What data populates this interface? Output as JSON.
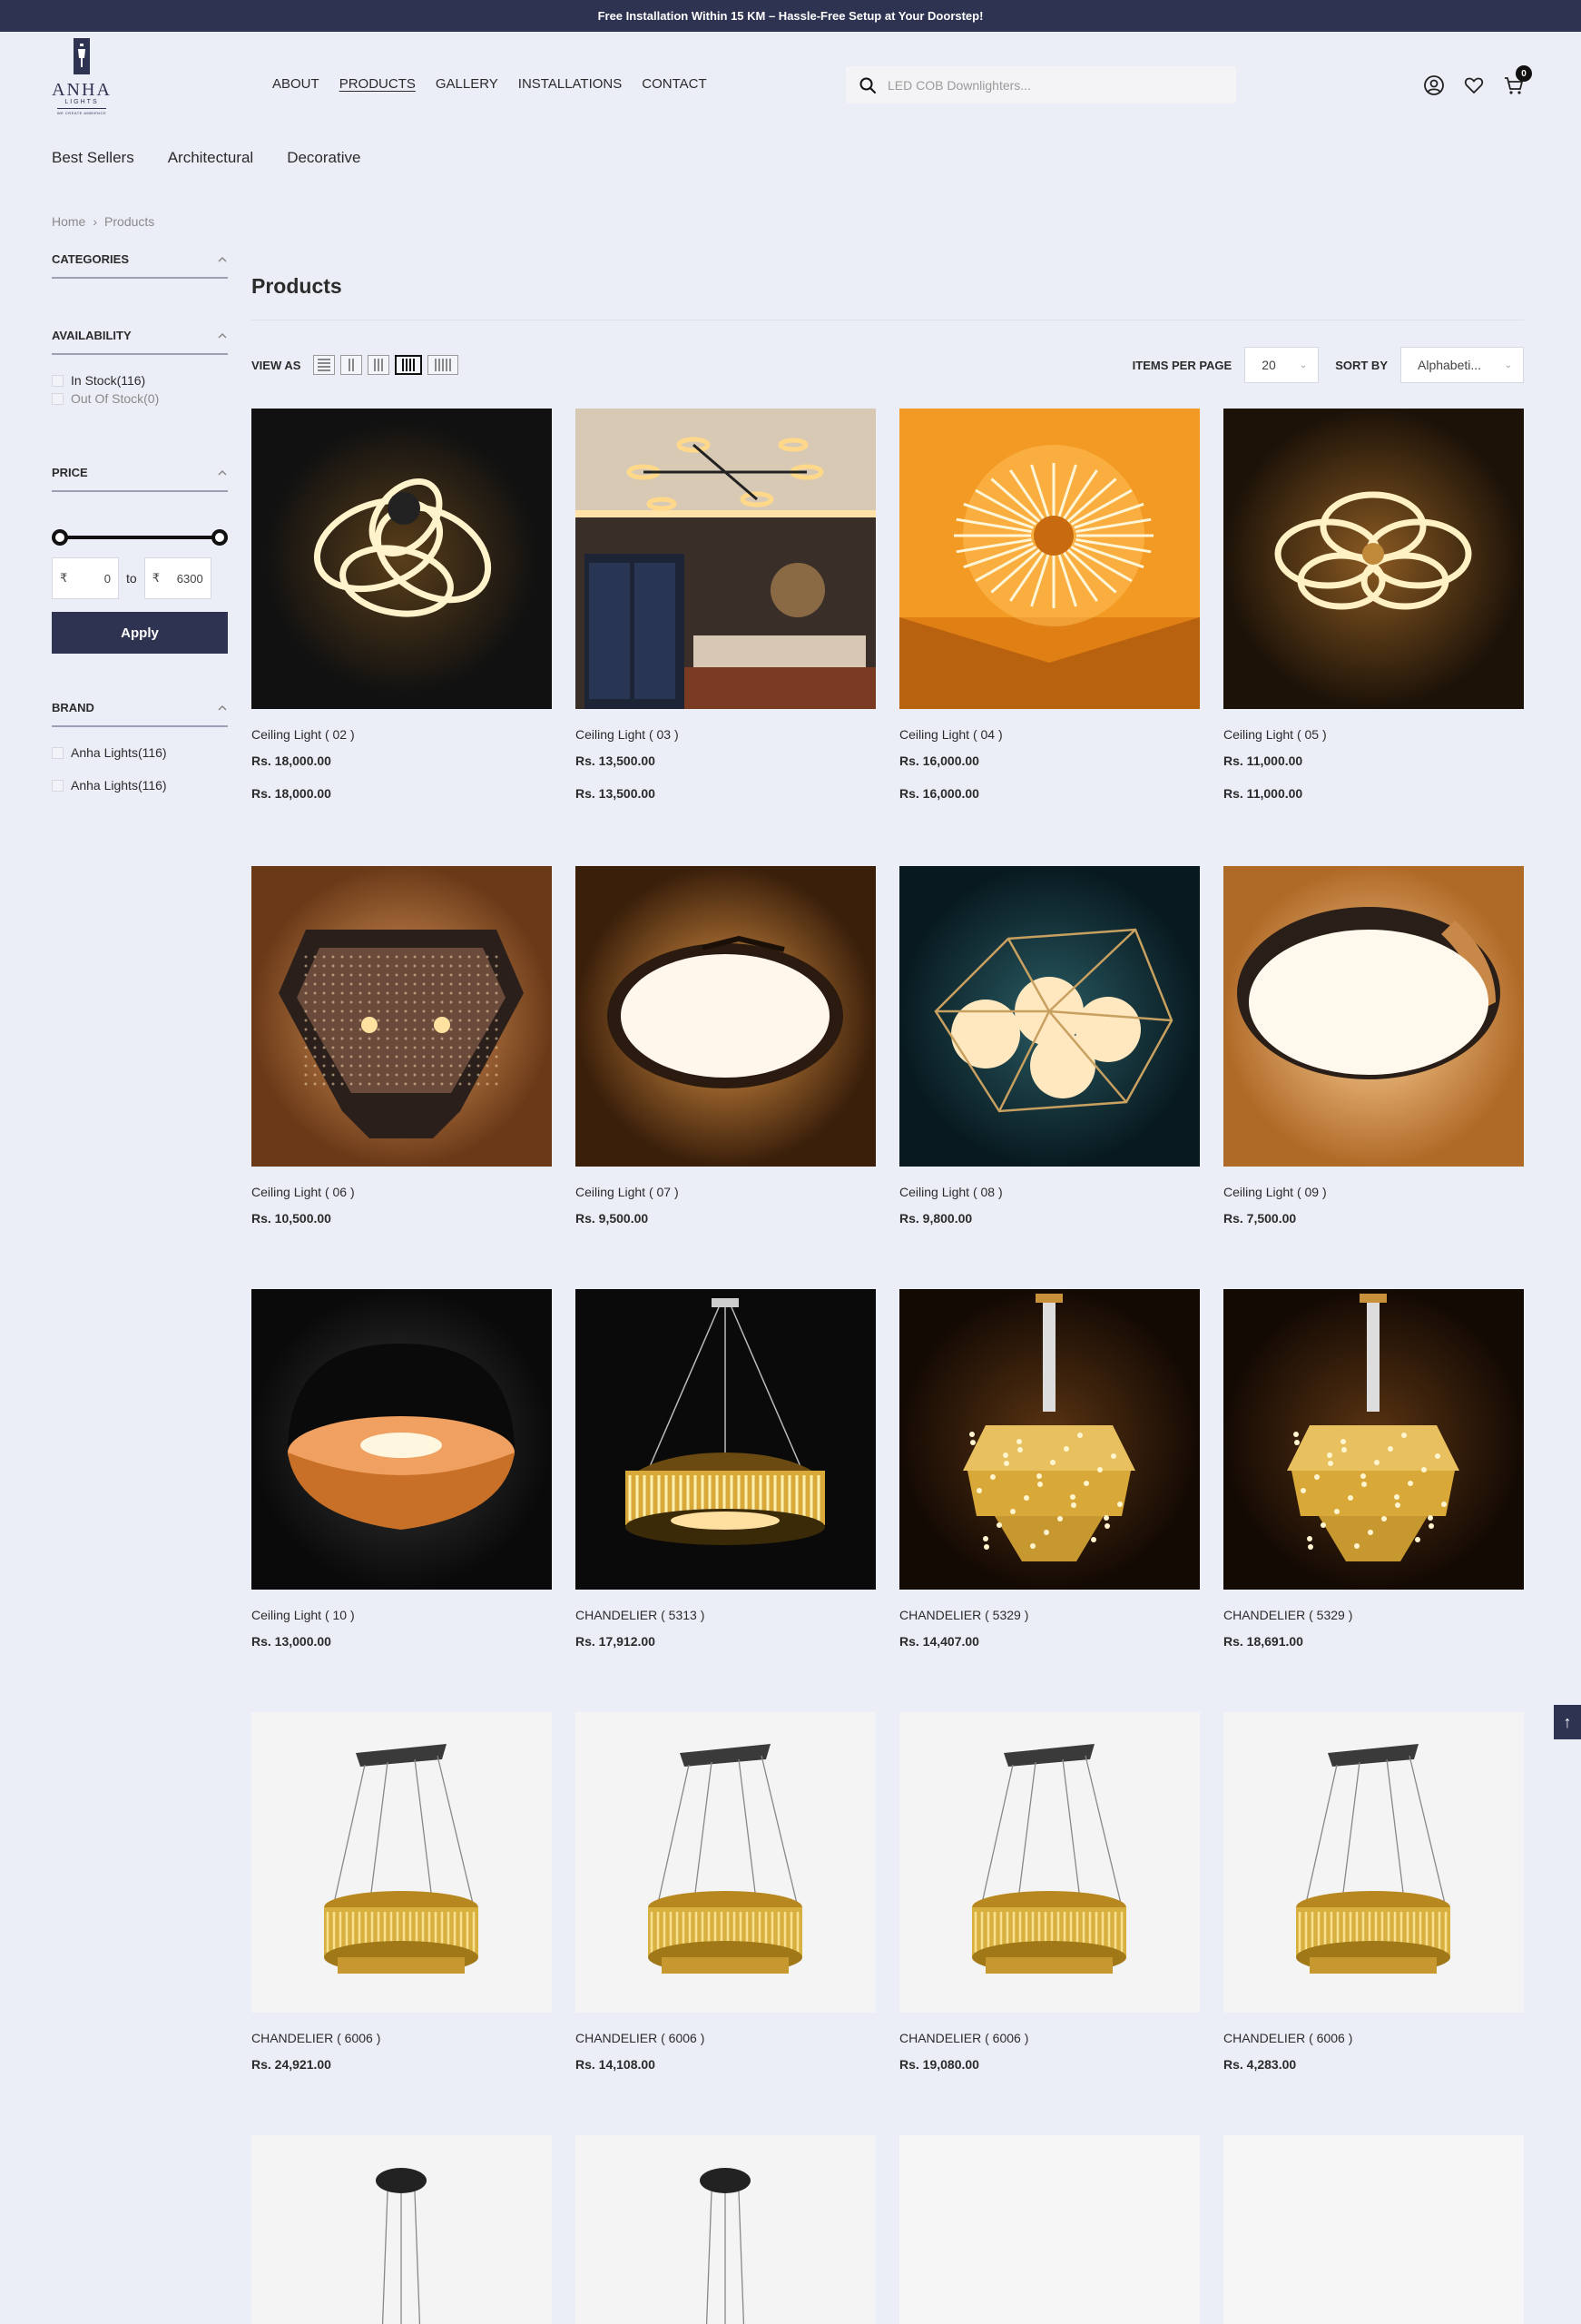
{
  "announcement": "Free Installation Within 15 KM – Hassle-Free Setup at Your Doorstep!",
  "logo": {
    "text": "ANHA",
    "sub": "LIGHTS",
    "tagline": "WE CREATE AMBIENCE"
  },
  "nav": {
    "items": [
      "ABOUT",
      "PRODUCTS",
      "GALLERY",
      "INSTALLATIONS",
      "CONTACT"
    ],
    "active": "PRODUCTS"
  },
  "search": {
    "placeholder": "LED COB Downlighters..."
  },
  "header_icons": [
    "user-icon",
    "heart-icon",
    "cart-icon"
  ],
  "cart": {
    "count": "0"
  },
  "subnav": [
    "Best Sellers",
    "Architectural",
    "Decorative"
  ],
  "breadcrumb": [
    "Home",
    "Products"
  ],
  "sidebar": {
    "categories": {
      "title": "CATEGORIES"
    },
    "availability": {
      "title": "AVAILABILITY",
      "options": [
        "In Stock(116)",
        "Out Of Stock(0)"
      ]
    },
    "price": {
      "title": "PRICE",
      "currency": "₹",
      "min": "0",
      "max": "6300",
      "separator": "to",
      "apply": "Apply"
    },
    "brand": {
      "title": "BRAND",
      "options": [
        "Anha Lights(116)",
        "Anha Lights(116)"
      ]
    }
  },
  "page_title": "Products",
  "toolbar": {
    "view_as": "VIEW AS",
    "view_modes": [
      "list",
      "2-col",
      "3-col",
      "4-col",
      "5-col"
    ],
    "active_view": "4-col",
    "items_per_page_label": "ITEMS PER PAGE",
    "items_per_page": "20",
    "sort_by_label": "SORT BY",
    "sort_by": "Alphabeti..."
  },
  "products": [
    {
      "name": "Ceiling Light ( 02 )",
      "price": "Rs. 18,000.00",
      "price2": "Rs. 18,000.00",
      "art": "swirl"
    },
    {
      "name": "Ceiling Light ( 03 )",
      "price": "Rs. 13,500.00",
      "price2": "Rs. 13,500.00",
      "art": "bedroom"
    },
    {
      "name": "Ceiling Light ( 04 )",
      "price": "Rs. 16,000.00",
      "price2": "Rs. 16,000.00",
      "art": "burst"
    },
    {
      "name": "Ceiling Light ( 05 )",
      "price": "Rs. 11,000.00",
      "price2": "Rs. 11,000.00",
      "art": "rings"
    },
    {
      "name": "Ceiling Light ( 06 )",
      "price": "Rs. 10,500.00",
      "art": "lantern"
    },
    {
      "name": "Ceiling Light ( 07 )",
      "price": "Rs. 9,500.00",
      "art": "disc"
    },
    {
      "name": "Ceiling Light ( 08 )",
      "price": "Rs. 9,800.00",
      "art": "globes"
    },
    {
      "name": "Ceiling Light ( 09 )",
      "price": "Rs. 7,500.00",
      "art": "disc-light"
    },
    {
      "name": "Ceiling Light ( 10 )",
      "price": "Rs. 13,000.00",
      "art": "dome"
    },
    {
      "name": "CHANDELIER ( 5313 )",
      "price": "Rs. 17,912.00",
      "art": "crystal-ring"
    },
    {
      "name": "CHANDELIER ( 5329 )",
      "price": "Rs. 14,407.00",
      "art": "crystal-tier"
    },
    {
      "name": "CHANDELIER ( 5329 )",
      "price": "Rs. 18,691.00",
      "art": "crystal-tier"
    },
    {
      "name": "CHANDELIER ( 6006 )",
      "price": "Rs. 24,921.00",
      "art": "oval"
    },
    {
      "name": "CHANDELIER ( 6006 )",
      "price": "Rs. 14,108.00",
      "art": "oval"
    },
    {
      "name": "CHANDELIER ( 6006 )",
      "price": "Rs. 19,080.00",
      "art": "oval"
    },
    {
      "name": "CHANDELIER ( 6006 )",
      "price": "Rs. 4,283.00",
      "art": "oval"
    },
    {
      "name": "",
      "price": "",
      "art": "pendant"
    },
    {
      "name": "",
      "price": "",
      "art": "pendant"
    },
    {
      "name": "",
      "price": "",
      "art": "blank"
    },
    {
      "name": "",
      "price": "",
      "art": "blank"
    }
  ],
  "scroll_top": "↑"
}
